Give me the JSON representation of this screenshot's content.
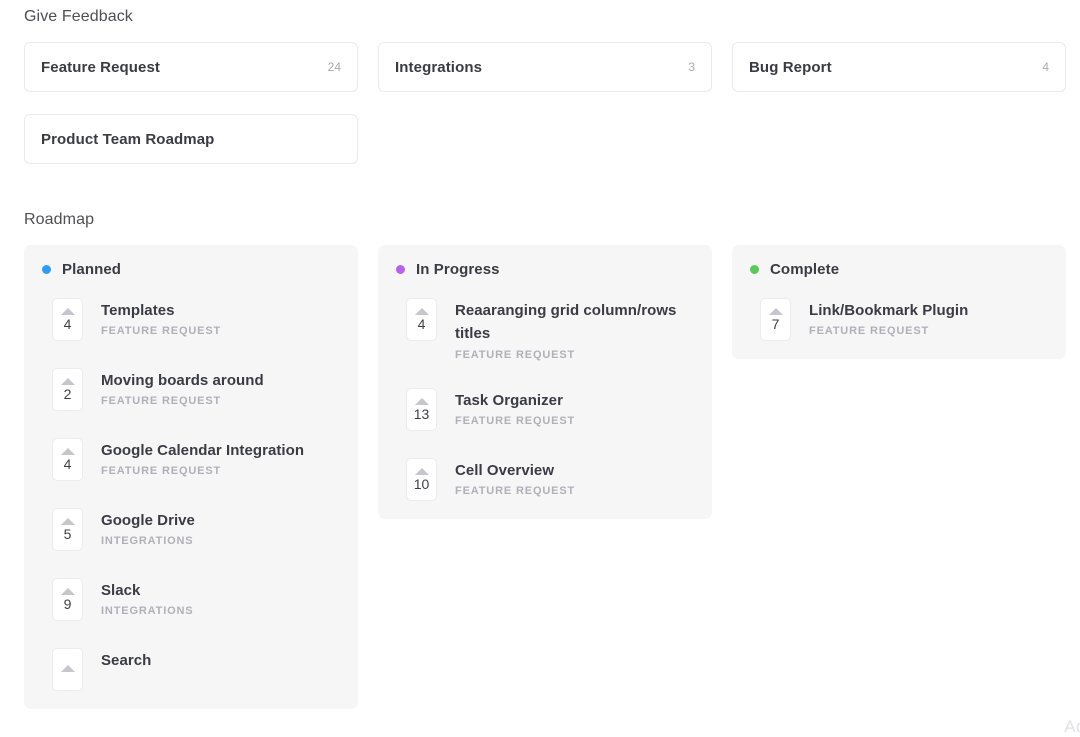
{
  "sections": {
    "give_feedback_title": "Give Feedback",
    "roadmap_title": "Roadmap"
  },
  "feedback_boards": [
    {
      "label": "Feature Request",
      "count": "24"
    },
    {
      "label": "Integrations",
      "count": "3"
    },
    {
      "label": "Bug Report",
      "count": "4"
    },
    {
      "label": "Product Team Roadmap",
      "count": ""
    }
  ],
  "roadmap_columns": [
    {
      "title": "Planned",
      "dot_color": "#2f9cf4",
      "items": [
        {
          "votes": "4",
          "title": "Templates",
          "category": "FEATURE REQUEST"
        },
        {
          "votes": "2",
          "title": "Moving boards around",
          "category": "FEATURE REQUEST"
        },
        {
          "votes": "4",
          "title": "Google Calendar Integration",
          "category": "FEATURE REQUEST"
        },
        {
          "votes": "5",
          "title": "Google Drive",
          "category": "INTEGRATIONS"
        },
        {
          "votes": "9",
          "title": "Slack",
          "category": "INTEGRATIONS"
        },
        {
          "votes": "",
          "title": "Search",
          "category": ""
        }
      ]
    },
    {
      "title": "In Progress",
      "dot_color": "#b861e8",
      "items": [
        {
          "votes": "4",
          "title": "Reaaranging grid column/rows titles",
          "category": "FEATURE REQUEST"
        },
        {
          "votes": "13",
          "title": "Task Organizer",
          "category": "FEATURE REQUEST"
        },
        {
          "votes": "10",
          "title": "Cell Overview",
          "category": "FEATURE REQUEST"
        }
      ]
    },
    {
      "title": "Complete",
      "dot_color": "#5ac85a",
      "items": [
        {
          "votes": "7",
          "title": "Link/Bookmark Plugin",
          "category": "FEATURE REQUEST"
        }
      ]
    }
  ],
  "corner_artifact": {
    "text": "Ad"
  },
  "icons": {
    "vote_arrow": "triangle-up-icon",
    "status_dot": "status-dot-icon"
  }
}
